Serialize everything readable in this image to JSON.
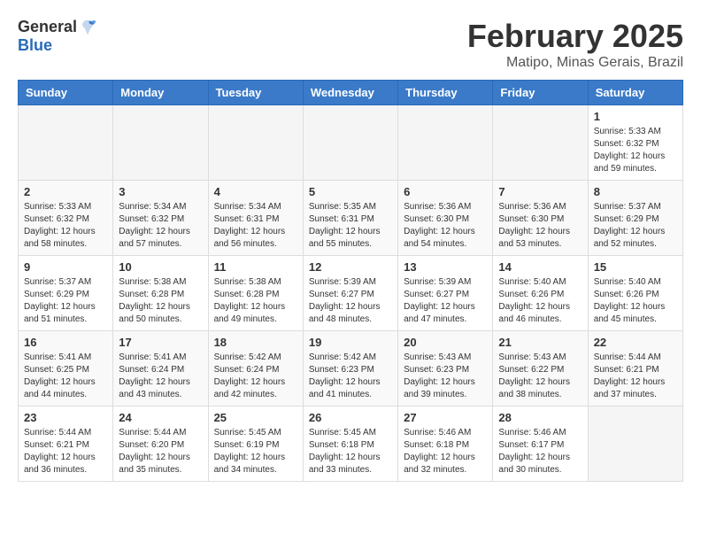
{
  "logo": {
    "general": "General",
    "blue": "Blue"
  },
  "title": {
    "month": "February 2025",
    "location": "Matipo, Minas Gerais, Brazil"
  },
  "headers": [
    "Sunday",
    "Monday",
    "Tuesday",
    "Wednesday",
    "Thursday",
    "Friday",
    "Saturday"
  ],
  "weeks": [
    [
      {
        "day": "",
        "info": ""
      },
      {
        "day": "",
        "info": ""
      },
      {
        "day": "",
        "info": ""
      },
      {
        "day": "",
        "info": ""
      },
      {
        "day": "",
        "info": ""
      },
      {
        "day": "",
        "info": ""
      },
      {
        "day": "1",
        "info": "Sunrise: 5:33 AM\nSunset: 6:32 PM\nDaylight: 12 hours and 59 minutes."
      }
    ],
    [
      {
        "day": "2",
        "info": "Sunrise: 5:33 AM\nSunset: 6:32 PM\nDaylight: 12 hours and 58 minutes."
      },
      {
        "day": "3",
        "info": "Sunrise: 5:34 AM\nSunset: 6:32 PM\nDaylight: 12 hours and 57 minutes."
      },
      {
        "day": "4",
        "info": "Sunrise: 5:34 AM\nSunset: 6:31 PM\nDaylight: 12 hours and 56 minutes."
      },
      {
        "day": "5",
        "info": "Sunrise: 5:35 AM\nSunset: 6:31 PM\nDaylight: 12 hours and 55 minutes."
      },
      {
        "day": "6",
        "info": "Sunrise: 5:36 AM\nSunset: 6:30 PM\nDaylight: 12 hours and 54 minutes."
      },
      {
        "day": "7",
        "info": "Sunrise: 5:36 AM\nSunset: 6:30 PM\nDaylight: 12 hours and 53 minutes."
      },
      {
        "day": "8",
        "info": "Sunrise: 5:37 AM\nSunset: 6:29 PM\nDaylight: 12 hours and 52 minutes."
      }
    ],
    [
      {
        "day": "9",
        "info": "Sunrise: 5:37 AM\nSunset: 6:29 PM\nDaylight: 12 hours and 51 minutes."
      },
      {
        "day": "10",
        "info": "Sunrise: 5:38 AM\nSunset: 6:28 PM\nDaylight: 12 hours and 50 minutes."
      },
      {
        "day": "11",
        "info": "Sunrise: 5:38 AM\nSunset: 6:28 PM\nDaylight: 12 hours and 49 minutes."
      },
      {
        "day": "12",
        "info": "Sunrise: 5:39 AM\nSunset: 6:27 PM\nDaylight: 12 hours and 48 minutes."
      },
      {
        "day": "13",
        "info": "Sunrise: 5:39 AM\nSunset: 6:27 PM\nDaylight: 12 hours and 47 minutes."
      },
      {
        "day": "14",
        "info": "Sunrise: 5:40 AM\nSunset: 6:26 PM\nDaylight: 12 hours and 46 minutes."
      },
      {
        "day": "15",
        "info": "Sunrise: 5:40 AM\nSunset: 6:26 PM\nDaylight: 12 hours and 45 minutes."
      }
    ],
    [
      {
        "day": "16",
        "info": "Sunrise: 5:41 AM\nSunset: 6:25 PM\nDaylight: 12 hours and 44 minutes."
      },
      {
        "day": "17",
        "info": "Sunrise: 5:41 AM\nSunset: 6:24 PM\nDaylight: 12 hours and 43 minutes."
      },
      {
        "day": "18",
        "info": "Sunrise: 5:42 AM\nSunset: 6:24 PM\nDaylight: 12 hours and 42 minutes."
      },
      {
        "day": "19",
        "info": "Sunrise: 5:42 AM\nSunset: 6:23 PM\nDaylight: 12 hours and 41 minutes."
      },
      {
        "day": "20",
        "info": "Sunrise: 5:43 AM\nSunset: 6:23 PM\nDaylight: 12 hours and 39 minutes."
      },
      {
        "day": "21",
        "info": "Sunrise: 5:43 AM\nSunset: 6:22 PM\nDaylight: 12 hours and 38 minutes."
      },
      {
        "day": "22",
        "info": "Sunrise: 5:44 AM\nSunset: 6:21 PM\nDaylight: 12 hours and 37 minutes."
      }
    ],
    [
      {
        "day": "23",
        "info": "Sunrise: 5:44 AM\nSunset: 6:21 PM\nDaylight: 12 hours and 36 minutes."
      },
      {
        "day": "24",
        "info": "Sunrise: 5:44 AM\nSunset: 6:20 PM\nDaylight: 12 hours and 35 minutes."
      },
      {
        "day": "25",
        "info": "Sunrise: 5:45 AM\nSunset: 6:19 PM\nDaylight: 12 hours and 34 minutes."
      },
      {
        "day": "26",
        "info": "Sunrise: 5:45 AM\nSunset: 6:18 PM\nDaylight: 12 hours and 33 minutes."
      },
      {
        "day": "27",
        "info": "Sunrise: 5:46 AM\nSunset: 6:18 PM\nDaylight: 12 hours and 32 minutes."
      },
      {
        "day": "28",
        "info": "Sunrise: 5:46 AM\nSunset: 6:17 PM\nDaylight: 12 hours and 30 minutes."
      },
      {
        "day": "",
        "info": ""
      }
    ]
  ]
}
